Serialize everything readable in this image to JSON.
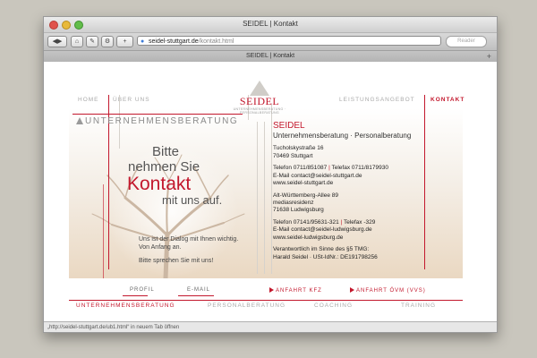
{
  "browser": {
    "window_title": "SEIDEL | Kontakt",
    "url_domain": "seidel-stuttgart.de",
    "url_path": "/kontakt.html",
    "reader_label": "Reader",
    "tab_title": "SEIDEL | Kontakt",
    "status_text": "„http://seidel-stuttgart.de/ub1.html“ in neuem Tab öffnen"
  },
  "nav": {
    "home": "HOME",
    "ueber": "ÜBER UNS",
    "leistung": "LEISTUNGSANGEBOT",
    "kontakt": "KONTAKT"
  },
  "logo": {
    "name": "SEIDEL",
    "subtitle": "UNTERNEHMENSBERATUNG · PERSONALBERATUNG"
  },
  "hero": {
    "section_title": "UNTERNEHMENSBERATUNG",
    "line1": "Bitte",
    "line2": "nehmen Sie",
    "line3": "Kontakt",
    "line4": "mit uns auf.",
    "para1": "Uns ist der Dialog mit Ihnen wichtig.",
    "para2": "Von Anfang an.",
    "para3": "Bitte sprechen Sie mit uns!"
  },
  "info": {
    "company": "SEIDEL",
    "tagline": "Unternehmensberatung · Personalberatung",
    "addr1_street": "Tucholskystraße 16",
    "addr1_city": "70469 Stuttgart",
    "phone1": "Telefon 0711/851087",
    "fax1": "Telefax 0711/8179930",
    "email1": "E-Mail contact@seidel-stuttgart.de",
    "web1": "www.seidel-stuttgart.de",
    "addr2_street": "Alt-Württemberg-Allee 89",
    "addr2_building": "mediasresidenz",
    "addr2_city": "71638 Ludwigsburg",
    "phone2": "Telefon 07141/95631-321",
    "fax2": "Telefax -329",
    "email2": "E-Mail contact@seidel-ludwigsburg.de",
    "web2": "www.seidel-ludwigsburg.de",
    "legal1": "Verantwortlich im Sinne des §5 TMG:",
    "legal2": "Harald Seidel · USt-IdNr.: DE191798256"
  },
  "subnav": {
    "profil": "PROFIL",
    "email": "E-MAIL",
    "anfahrt_kfz": "ANFAHRT KFZ",
    "anfahrt_oevm": "ANFAHRT ÖVM (VVS)"
  },
  "bottomnav": {
    "ub": "UNTERNEHMENSBERATUNG",
    "pb": "PERSONALBERATUNG",
    "coaching": "COACHING",
    "training": "TRAINING"
  }
}
